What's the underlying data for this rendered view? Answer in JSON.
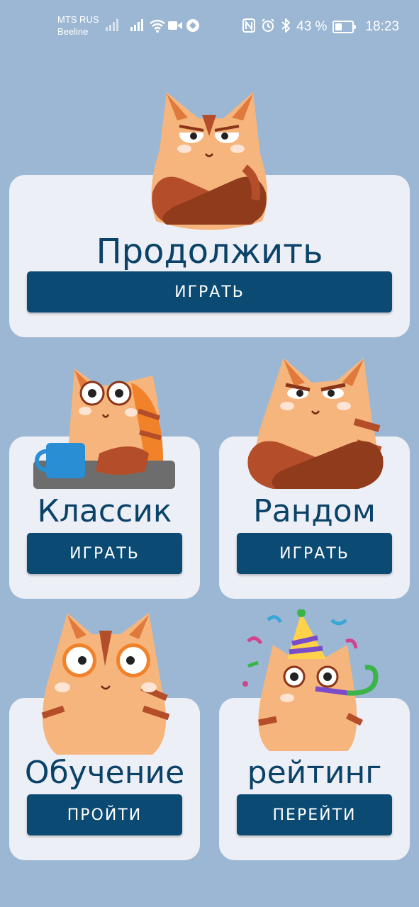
{
  "status_bar": {
    "carrier_1": "MTS RUS",
    "carrier_2": "Beeline",
    "battery_percent": "43 %",
    "time": "18:23"
  },
  "cards": {
    "continue": {
      "title": "Продолжить",
      "button": "ИГРАТЬ",
      "cat_icon": "cat-arms-crossed-icon"
    },
    "classic": {
      "title": "Классик",
      "button": "ИГРАТЬ",
      "cat_icon": "cat-with-mug-icon"
    },
    "random": {
      "title": "Рандом",
      "button": "ИГРАТЬ",
      "cat_icon": "cat-suspicious-icon"
    },
    "tutorial": {
      "title": "Обучение",
      "button": "ПРОЙТИ",
      "cat_icon": "cat-wide-eyed-icon"
    },
    "rating": {
      "title": "рейтинг",
      "button": "ПЕРЕЙТИ",
      "cat_icon": "cat-party-icon"
    }
  },
  "colors": {
    "background": "#9cb7d3",
    "card": "#edeff6",
    "button": "#0a4a73",
    "title": "#0a4268",
    "cat_fur": "#f6b57c",
    "cat_stripes": "#b44e2a"
  }
}
